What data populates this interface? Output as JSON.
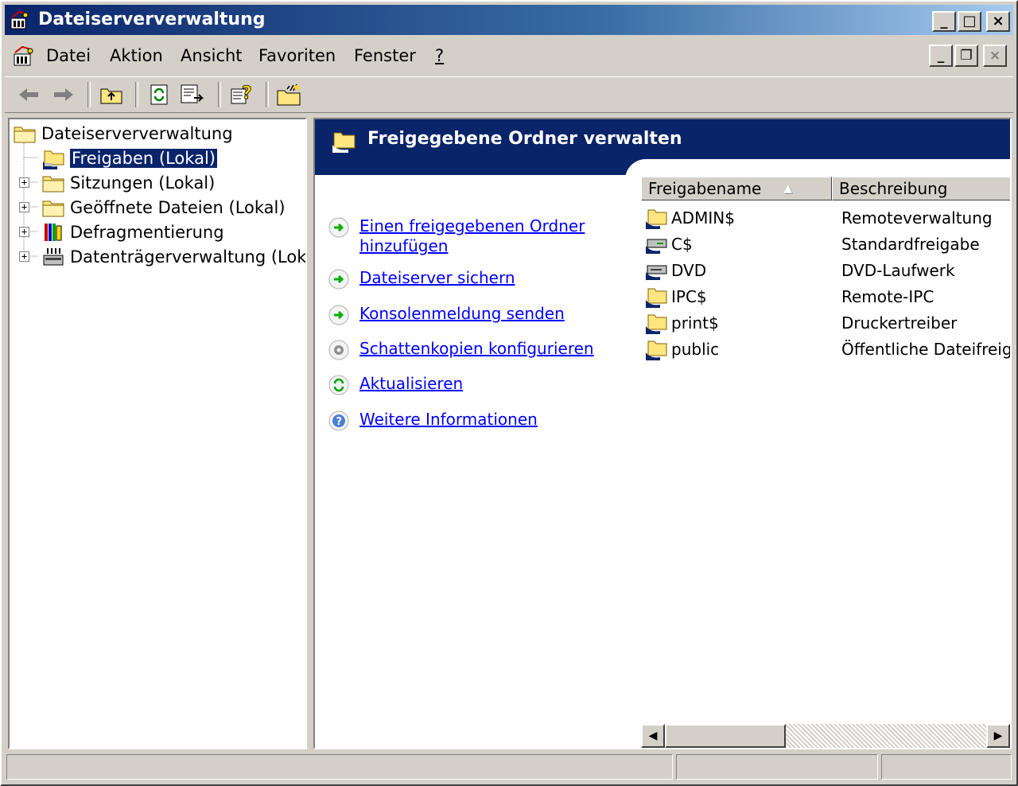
{
  "window": {
    "title": "Dateiserververwaltung",
    "icon": "mmc-snapin-icon",
    "controls": {
      "minimize": "_",
      "maximize": "□",
      "close": "×"
    },
    "accent": "#0a246a"
  },
  "menubar": {
    "items": [
      "Datei",
      "Aktion",
      "Ansicht",
      "Favoriten",
      "Fenster",
      "?"
    ],
    "mdi_controls": {
      "minimize": "_",
      "restore": "❐",
      "close": "×"
    }
  },
  "toolbar": {
    "buttons": [
      "back-arrow",
      "forward-arrow",
      "up-folder",
      "refresh",
      "export-list",
      "help",
      "share-folder"
    ]
  },
  "tree": {
    "root": "Dateiserververwaltung",
    "items": [
      {
        "label": "Freigaben (Lokal)",
        "selected": true,
        "expandable": false,
        "icon": "shared-folder-icon"
      },
      {
        "label": "Sitzungen (Lokal)",
        "selected": false,
        "expandable": true,
        "icon": "sessions-folder-icon"
      },
      {
        "label": "Geöffnete Dateien (Lokal)",
        "selected": false,
        "expandable": true,
        "icon": "open-files-folder-icon"
      },
      {
        "label": "Defragmentierung",
        "selected": false,
        "expandable": true,
        "icon": "defrag-icon"
      },
      {
        "label": "Datenträgerverwaltung (Lokal)",
        "selected": false,
        "expandable": true,
        "icon": "disk-management-icon"
      }
    ]
  },
  "taskpad": {
    "banner_title": "Freigegebene Ordner verwalten",
    "tasks": [
      {
        "label": "Einen freigegebenen Ordner hinzufügen",
        "line1": "Einen freigegebenen Ordner",
        "line2": "hinzufügen",
        "icon": "green-arrow-icon"
      },
      {
        "label": "Dateiserver sichern",
        "icon": "green-arrow-icon"
      },
      {
        "label": "Konsolenmeldung senden",
        "icon": "green-arrow-icon"
      },
      {
        "label": "Schattenkopien konfigurieren",
        "icon": "gear-icon"
      },
      {
        "label": "Aktualisieren",
        "icon": "refresh-icon"
      },
      {
        "label": "Weitere Informationen",
        "icon": "help-icon"
      }
    ]
  },
  "listview": {
    "columns": [
      {
        "label": "Freigabename",
        "sort": "ascending"
      },
      {
        "label": "Beschreibung"
      }
    ],
    "rows": [
      {
        "name": "ADMIN$",
        "description": "Remoteverwaltung",
        "icon": "shared-folder-icon"
      },
      {
        "name": "C$",
        "description": "Standardfreigabe",
        "icon": "shared-drive-icon"
      },
      {
        "name": "DVD",
        "description": "DVD-Laufwerk",
        "icon": "shared-drive-icon"
      },
      {
        "name": "IPC$",
        "description": "Remote-IPC",
        "icon": "shared-folder-icon"
      },
      {
        "name": "print$",
        "description": "Druckertreiber",
        "icon": "shared-folder-icon"
      },
      {
        "name": "public",
        "description": "Öffentliche Dateifreiga",
        "icon": "shared-folder-icon"
      }
    ]
  },
  "statusbar": {
    "panels": [
      "",
      "",
      ""
    ]
  }
}
